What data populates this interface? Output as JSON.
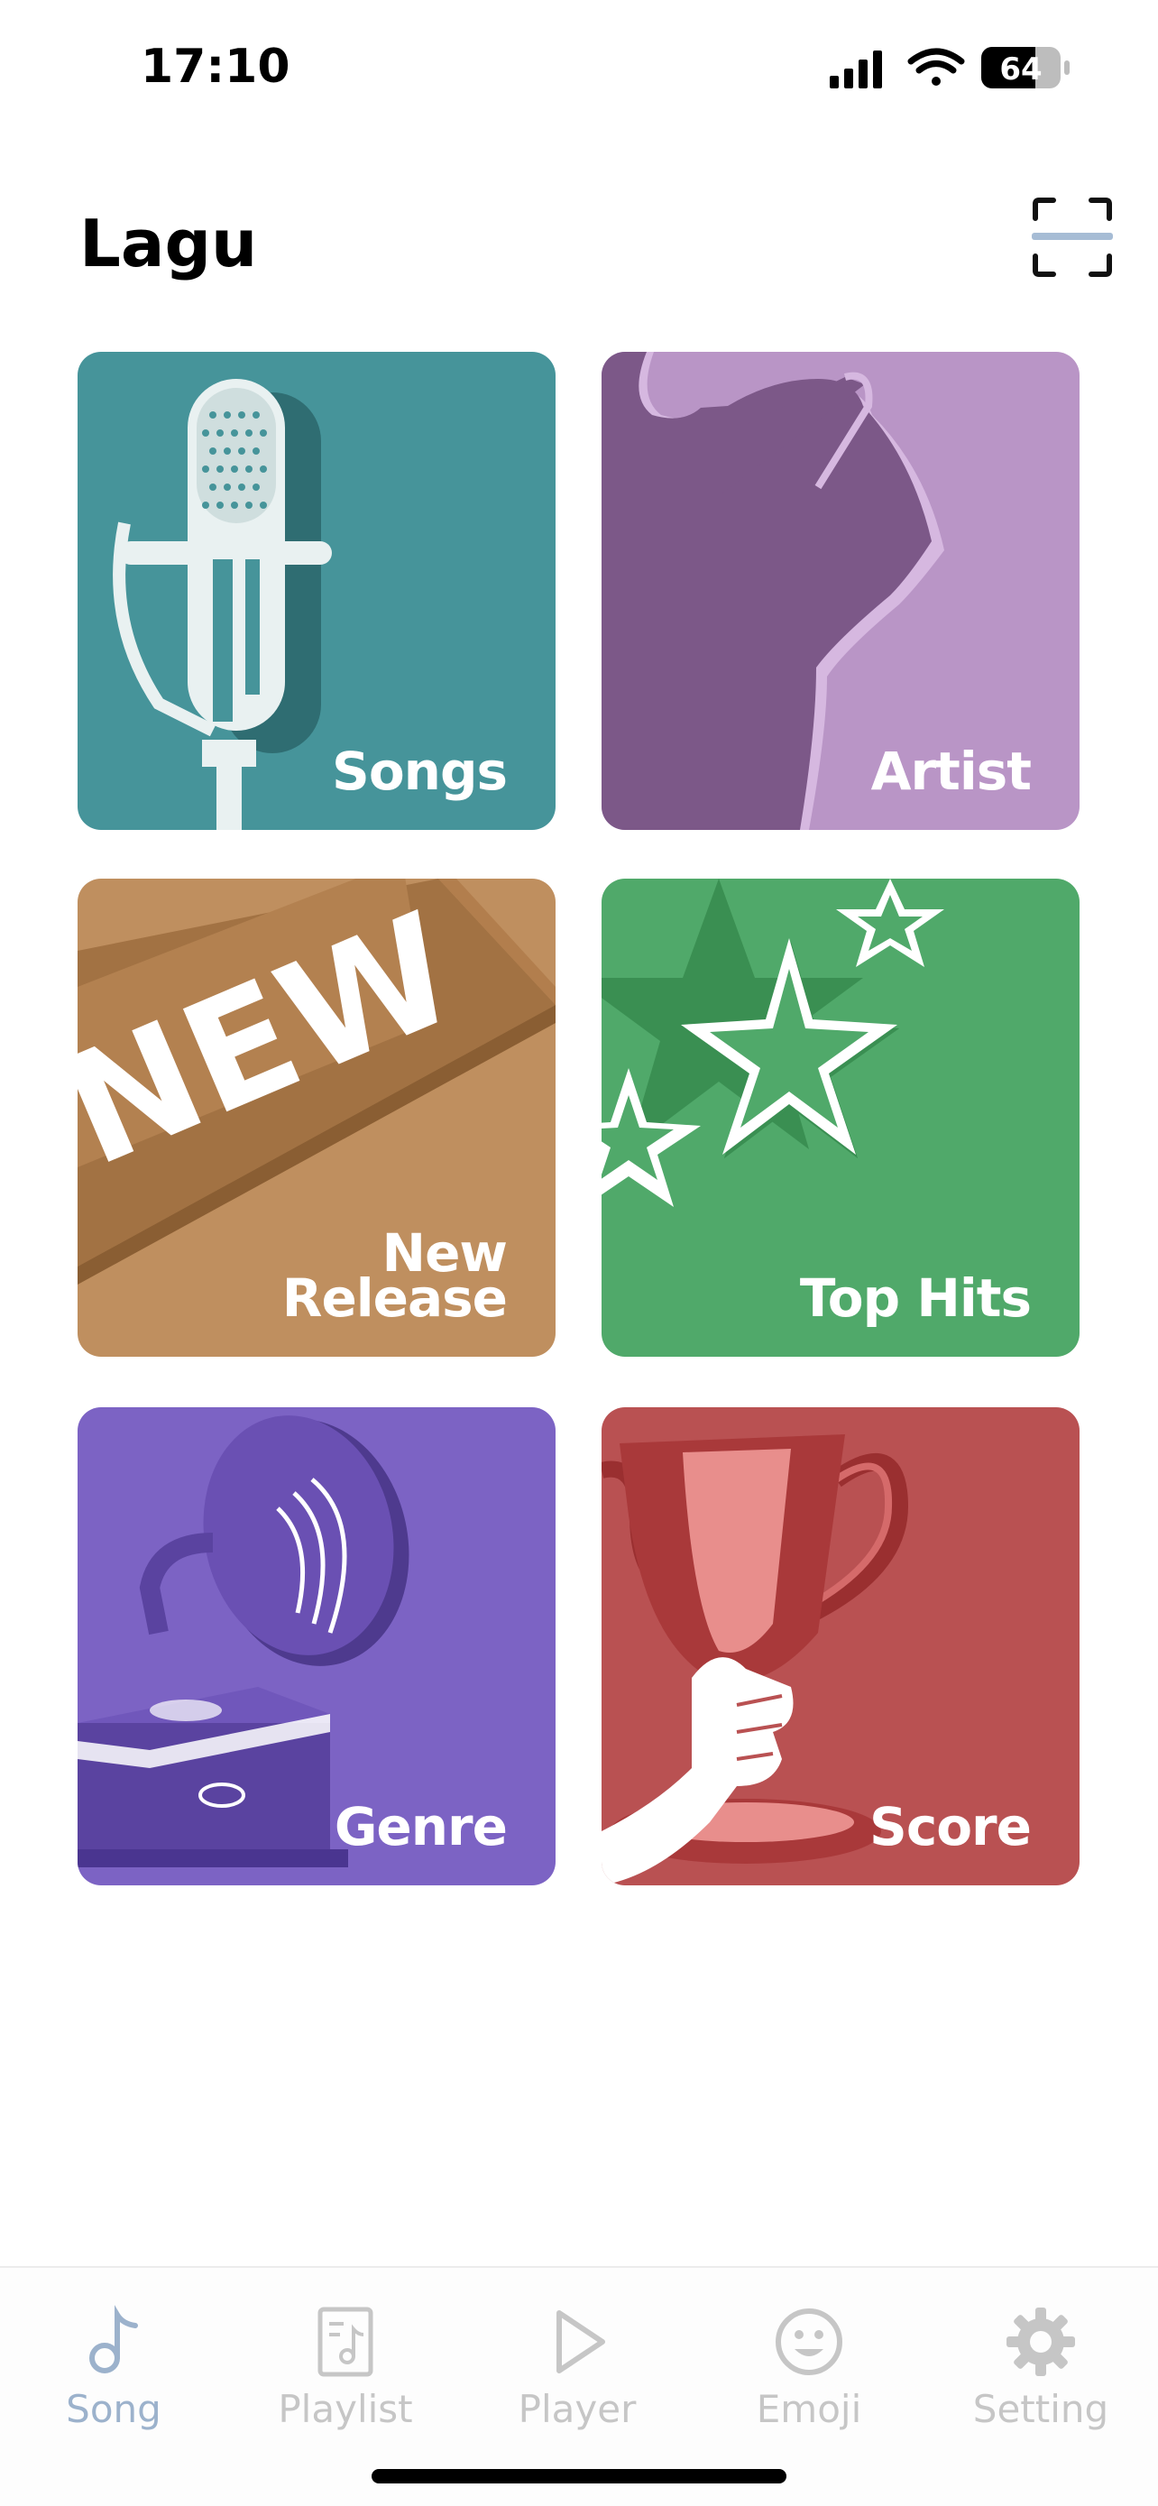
{
  "status_bar": {
    "time": "17:10",
    "battery_level": "64",
    "icons": [
      "signal-icon",
      "wifi-icon",
      "battery-icon"
    ]
  },
  "header": {
    "title": "Lagu",
    "action_icon": "scan-icon"
  },
  "tiles": [
    {
      "label": "Songs",
      "icon": "microphone-icon",
      "color": "#46949a"
    },
    {
      "label": "Artist",
      "icon": "singer-icon",
      "color": "#b995c6"
    },
    {
      "label_lines": [
        "New",
        "Release"
      ],
      "icon": "new-sign-icon",
      "color": "#bf8f5f"
    },
    {
      "label": "Top Hits",
      "icon": "stars-icon",
      "color": "#50a96a"
    },
    {
      "label": "Genre",
      "icon": "gramophone-icon",
      "color": "#7c63c4"
    },
    {
      "label": "Score",
      "icon": "trophy-icon",
      "color": "#b95152"
    }
  ],
  "tab_bar": {
    "active": "Song",
    "active_color": "#9cb2cc",
    "inactive_color": "#c6c6c6",
    "tabs": [
      {
        "label": "Song",
        "icon": "music-note-icon"
      },
      {
        "label": "Playlist",
        "icon": "playlist-icon"
      },
      {
        "label": "Player",
        "icon": "play-icon"
      },
      {
        "label": "Emoji",
        "icon": "smiley-icon"
      },
      {
        "label": "Setting",
        "icon": "gear-icon"
      }
    ]
  }
}
